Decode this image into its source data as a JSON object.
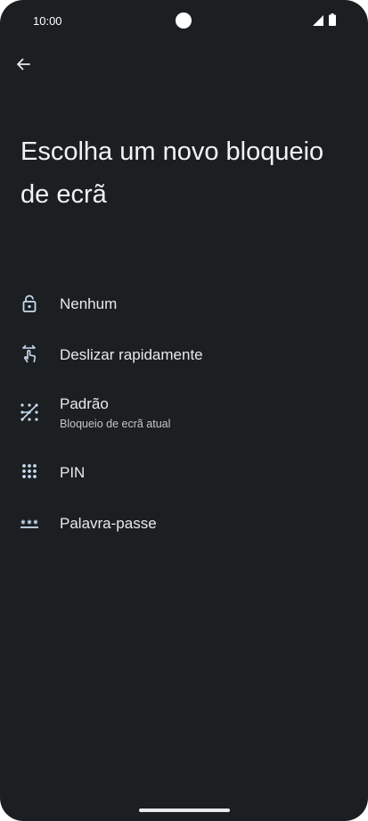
{
  "status_bar": {
    "time": "10:00"
  },
  "header": {
    "back_icon": "arrow-left-icon",
    "title": "Escolha um novo bloqueio de ecrã"
  },
  "options": [
    {
      "label": "Nenhum",
      "icon": "lock-open-icon"
    },
    {
      "label": "Deslizar rapidamente",
      "icon": "swipe-icon"
    },
    {
      "label": "Padrão",
      "subtitle": "Bloqueio de ecrã atual",
      "icon": "pattern-icon"
    },
    {
      "label": "PIN",
      "icon": "pin-icon"
    },
    {
      "label": "Palavra-passe",
      "icon": "password-icon"
    }
  ],
  "colors": {
    "background": "#1b1f22",
    "text": "#e8eaed",
    "icon": "#c7d9ee"
  }
}
